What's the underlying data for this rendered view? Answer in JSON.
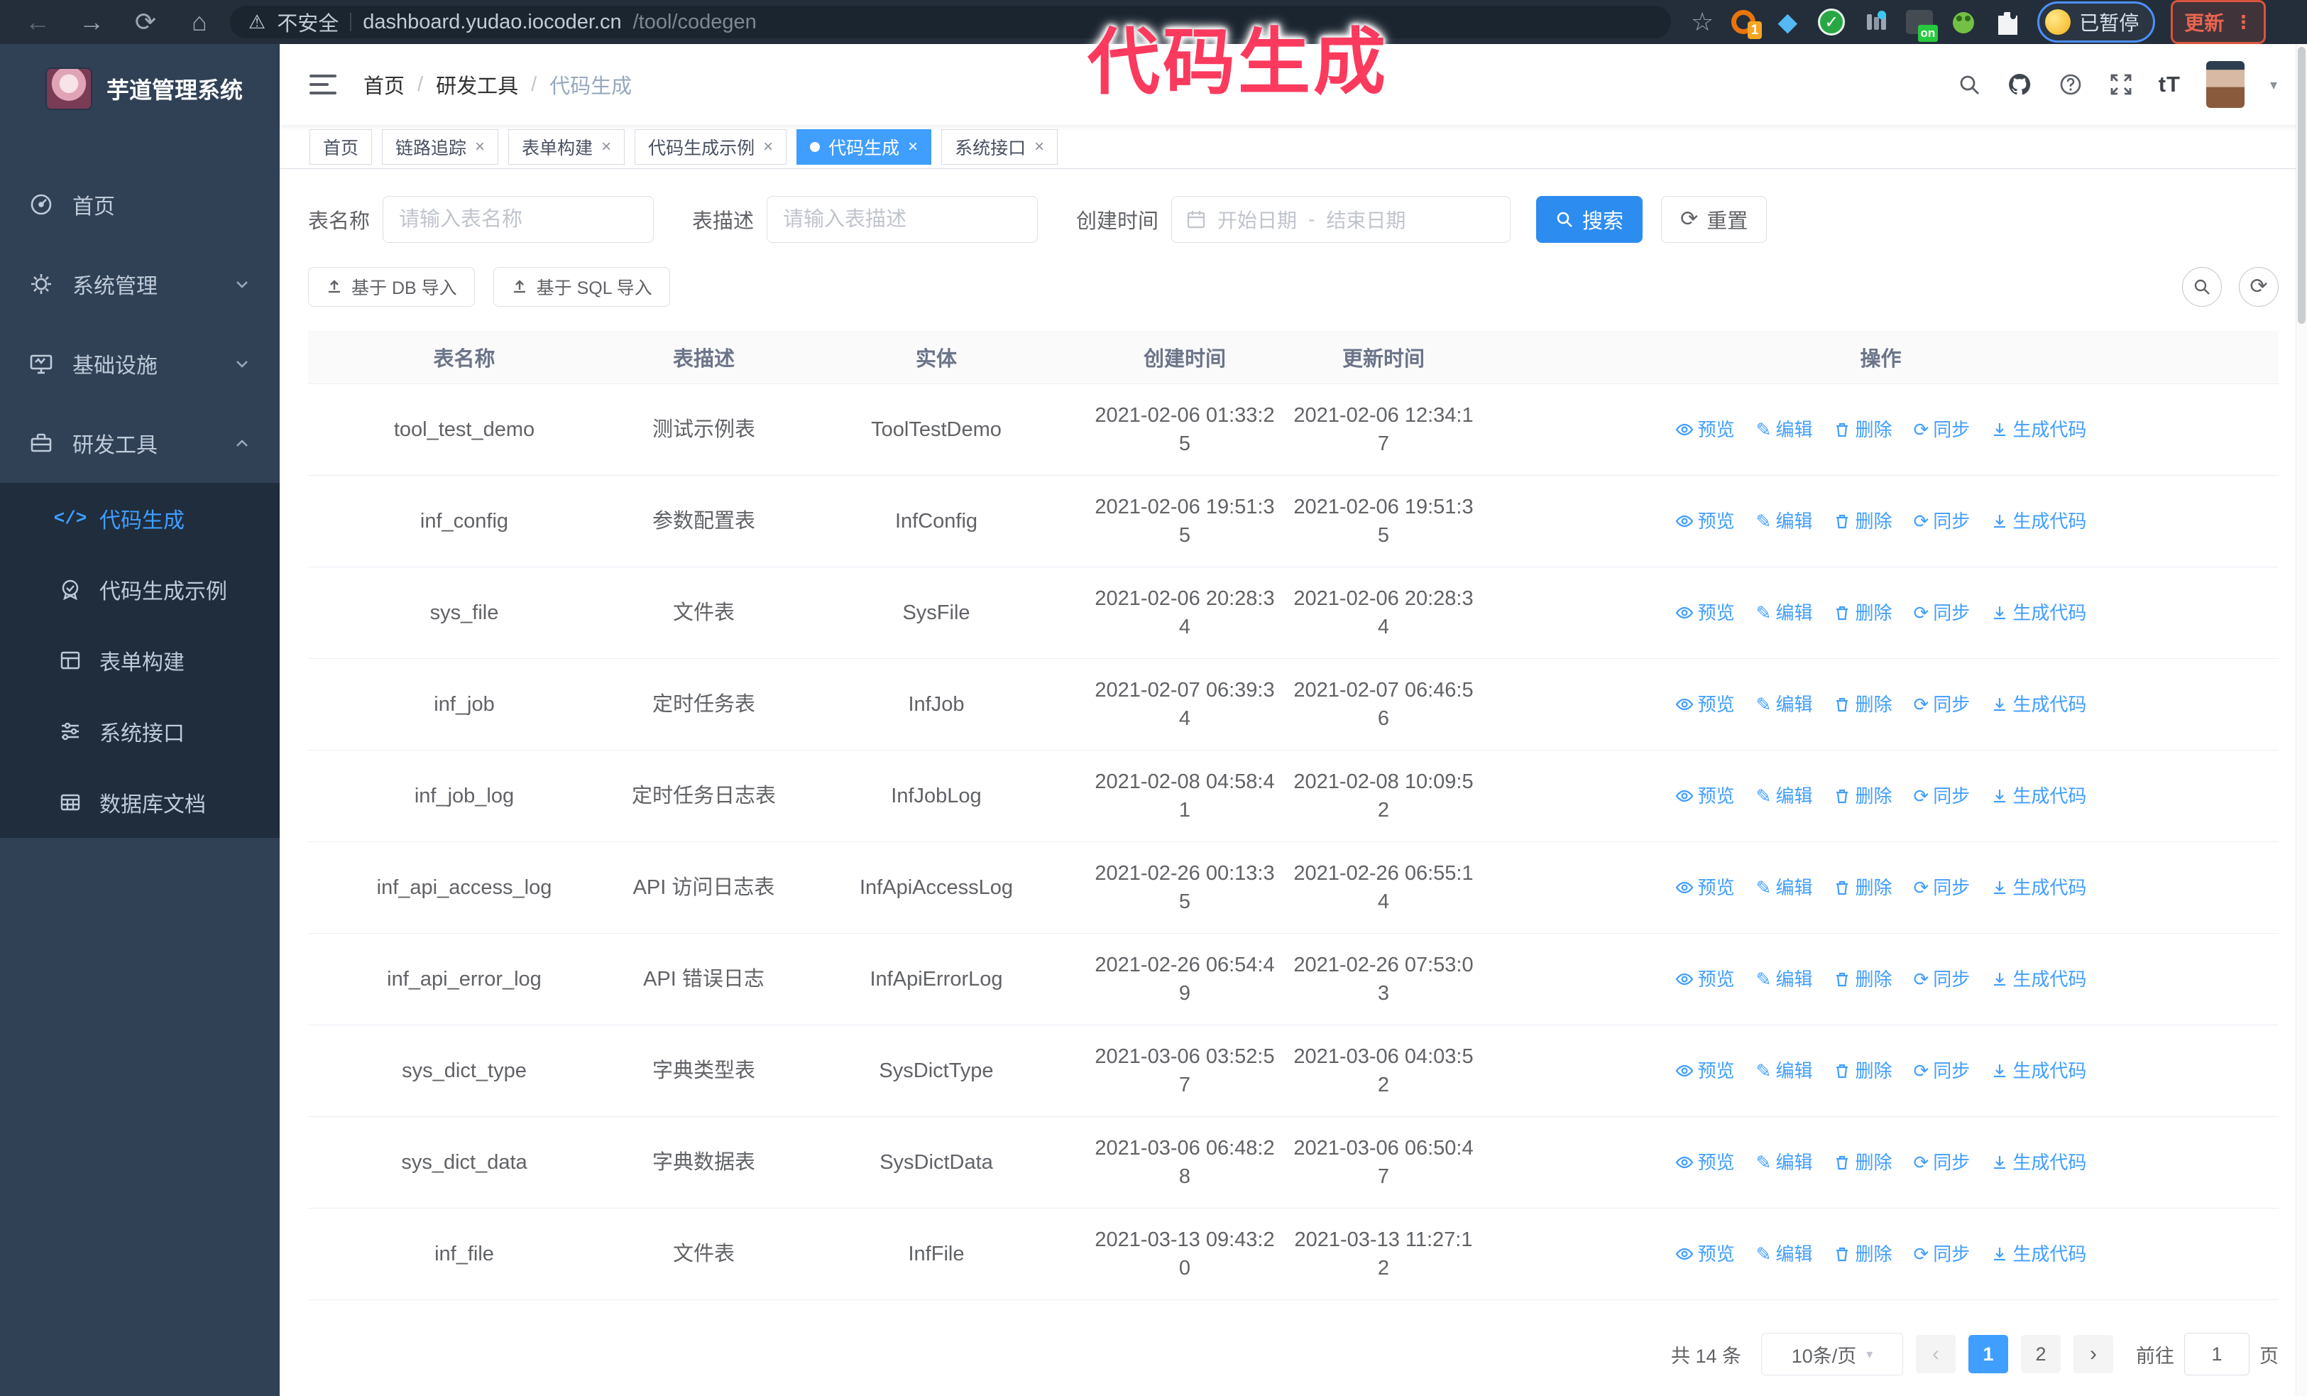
{
  "browser": {
    "security_label": "不安全",
    "url_host": "dashboard.yudao.iocoder.cn",
    "url_path": "/tool/codegen",
    "extension_badge": "1",
    "extension_on_badge": "on",
    "paused_label": "已暂停",
    "update_label": "更新"
  },
  "overlay": {
    "text": "代码生成"
  },
  "sidebar": {
    "title": "芋道管理系统",
    "items": [
      {
        "label": "首页"
      },
      {
        "label": "系统管理"
      },
      {
        "label": "基础设施"
      },
      {
        "label": "研发工具"
      }
    ],
    "submenu": [
      {
        "label": "代码生成",
        "active": true
      },
      {
        "label": "代码生成示例"
      },
      {
        "label": "表单构建"
      },
      {
        "label": "系统接口"
      },
      {
        "label": "数据库文档"
      }
    ]
  },
  "header": {
    "breadcrumb": [
      "首页",
      "研发工具",
      "代码生成"
    ]
  },
  "tabs": [
    {
      "label": "首页",
      "closable": false,
      "active": false
    },
    {
      "label": "链路追踪",
      "closable": true,
      "active": false
    },
    {
      "label": "表单构建",
      "closable": true,
      "active": false
    },
    {
      "label": "代码生成示例",
      "closable": true,
      "active": false
    },
    {
      "label": "代码生成",
      "closable": true,
      "active": true
    },
    {
      "label": "系统接口",
      "closable": true,
      "active": false
    }
  ],
  "search_form": {
    "table_name_label": "表名称",
    "table_name_placeholder": "请输入表名称",
    "table_desc_label": "表描述",
    "table_desc_placeholder": "请输入表描述",
    "create_time_label": "创建时间",
    "date_start_placeholder": "开始日期",
    "date_separator": "-",
    "date_end_placeholder": "结束日期",
    "search_label": "搜索",
    "reset_label": "重置"
  },
  "toolbar": {
    "import_db_label": "基于 DB 导入",
    "import_sql_label": "基于 SQL 导入"
  },
  "table": {
    "columns": [
      "表名称",
      "表描述",
      "实体",
      "创建时间",
      "更新时间",
      "操作"
    ],
    "actions": [
      "预览",
      "编辑",
      "删除",
      "同步",
      "生成代码"
    ],
    "rows": [
      {
        "name": "tool_test_demo",
        "desc": "测试示例表",
        "entity": "ToolTestDemo",
        "created": "2021-02-06 01:33:25",
        "updated": "2021-02-06 12:34:17"
      },
      {
        "name": "inf_config",
        "desc": "参数配置表",
        "entity": "InfConfig",
        "created": "2021-02-06 19:51:35",
        "updated": "2021-02-06 19:51:35"
      },
      {
        "name": "sys_file",
        "desc": "文件表",
        "entity": "SysFile",
        "created": "2021-02-06 20:28:34",
        "updated": "2021-02-06 20:28:34"
      },
      {
        "name": "inf_job",
        "desc": "定时任务表",
        "entity": "InfJob",
        "created": "2021-02-07 06:39:34",
        "updated": "2021-02-07 06:46:56"
      },
      {
        "name": "inf_job_log",
        "desc": "定时任务日志表",
        "entity": "InfJobLog",
        "created": "2021-02-08 04:58:41",
        "updated": "2021-02-08 10:09:52"
      },
      {
        "name": "inf_api_access_log",
        "desc": "API 访问日志表",
        "entity": "InfApiAccessLog",
        "created": "2021-02-26 00:13:35",
        "updated": "2021-02-26 06:55:14"
      },
      {
        "name": "inf_api_error_log",
        "desc": "API 错误日志",
        "entity": "InfApiErrorLog",
        "created": "2021-02-26 06:54:49",
        "updated": "2021-02-26 07:53:03"
      },
      {
        "name": "sys_dict_type",
        "desc": "字典类型表",
        "entity": "SysDictType",
        "created": "2021-03-06 03:52:57",
        "updated": "2021-03-06 04:03:52"
      },
      {
        "name": "sys_dict_data",
        "desc": "字典数据表",
        "entity": "SysDictData",
        "created": "2021-03-06 06:48:28",
        "updated": "2021-03-06 06:50:47"
      },
      {
        "name": "inf_file",
        "desc": "文件表",
        "entity": "InfFile",
        "created": "2021-03-13 09:43:20",
        "updated": "2021-03-13 11:27:12"
      }
    ]
  },
  "pagination": {
    "total_label": "共 14 条",
    "page_size": "10条/页",
    "pages": [
      "1",
      "2"
    ],
    "active_page": "1",
    "goto_label": "前往",
    "goto_value": "1",
    "page_suffix": "页"
  },
  "colors": {
    "accent": "#409eff",
    "sidebar_bg": "#304156",
    "submenu_bg": "#1f2d3d",
    "overlay_pink": "#fb3a5e",
    "chrome_bg": "#232e3a",
    "update_red": "#d9543e",
    "paused_blue": "#4d90fe"
  }
}
